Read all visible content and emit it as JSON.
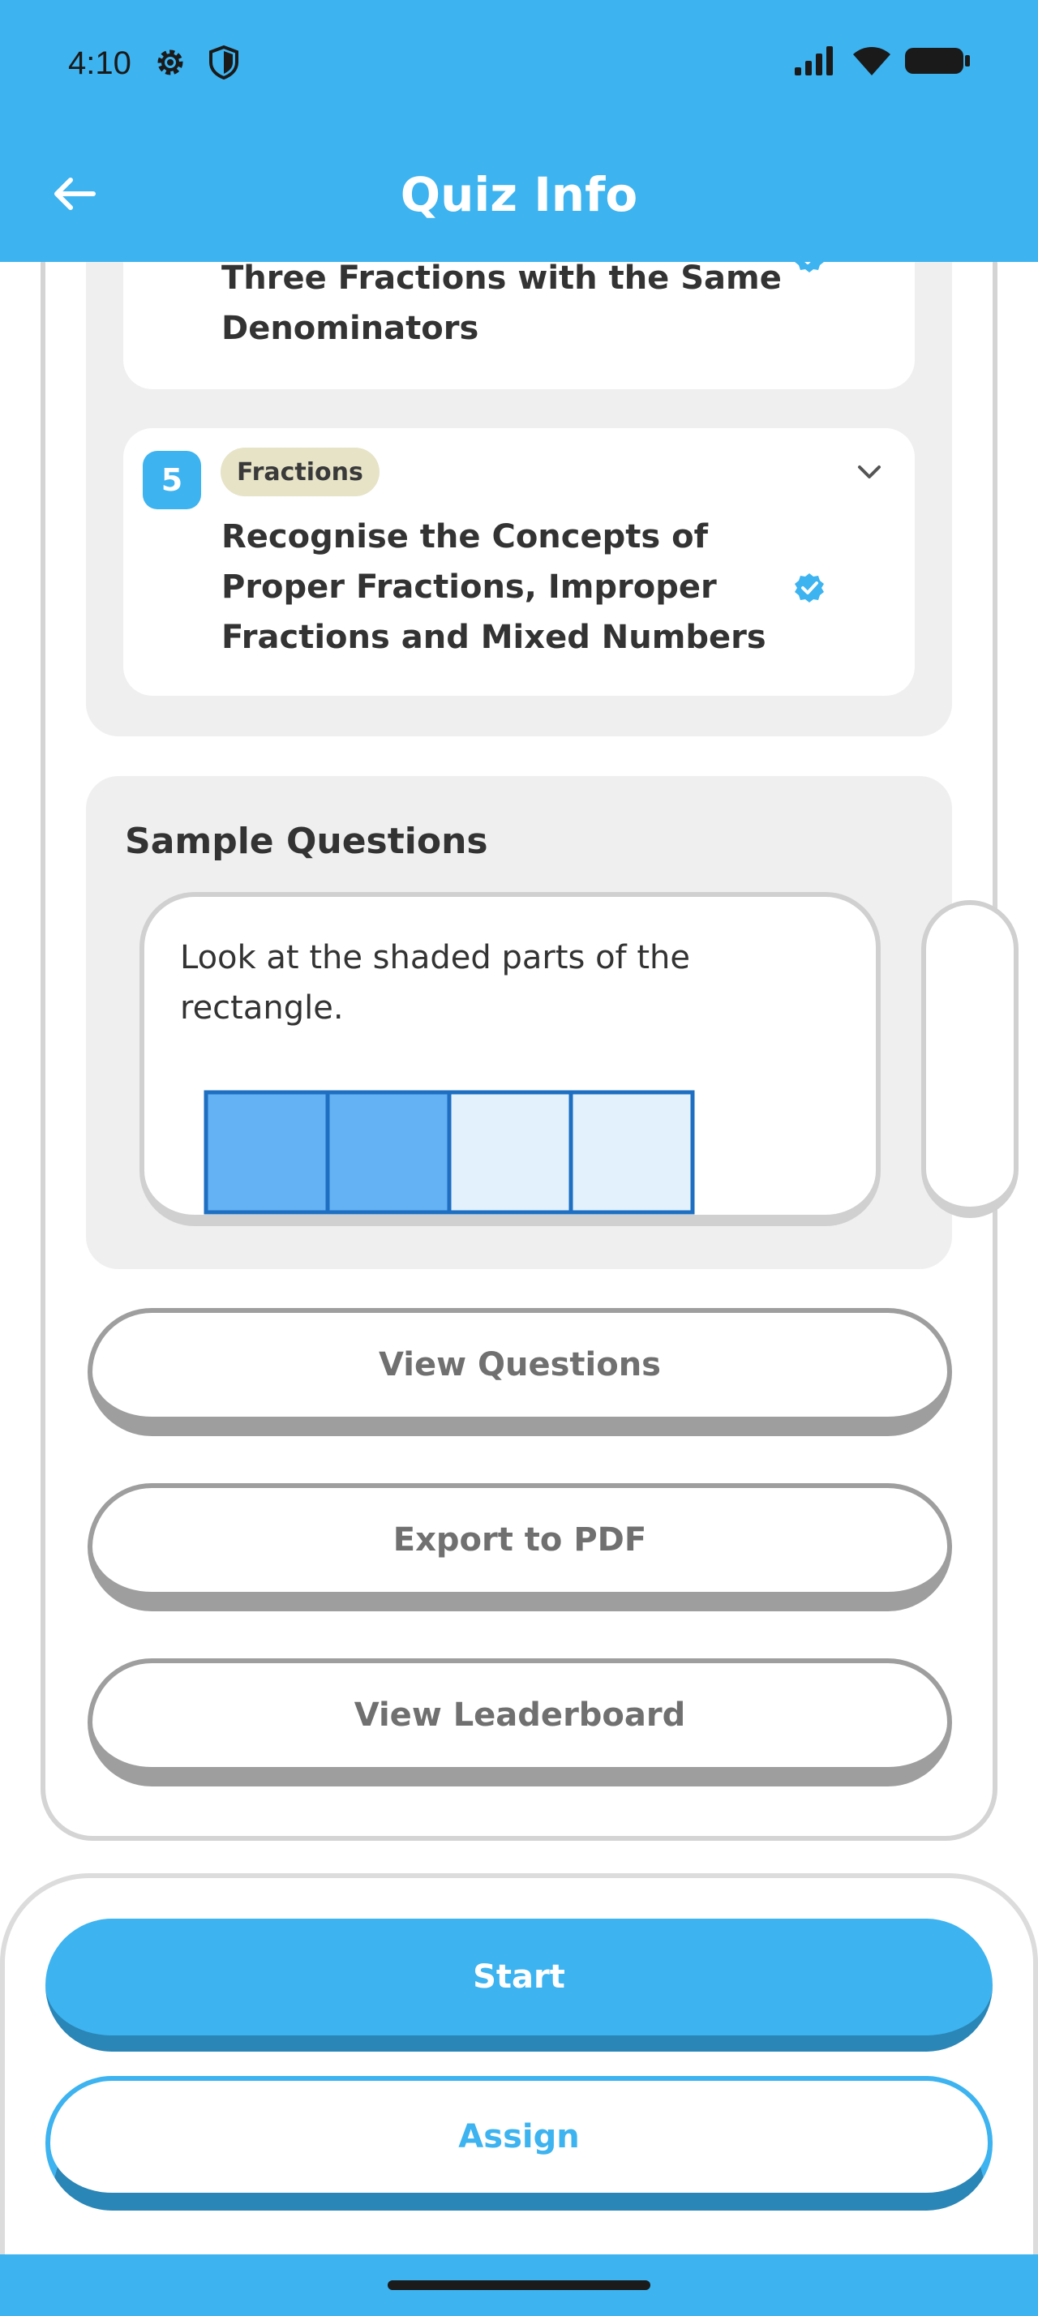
{
  "status_bar": {
    "time": "4:10",
    "left_icons": [
      "gear-icon",
      "shield-icon"
    ],
    "right_icons": [
      "signal-icon",
      "wifi-icon",
      "battery-icon"
    ]
  },
  "header": {
    "title": "Quiz Info",
    "back_icon": "arrow-left-icon",
    "background_color": "#3db3f0"
  },
  "learning_objectives": [
    {
      "title_lines": [
        "Three Fractions with the Same",
        "Denominators"
      ],
      "verified": true
    },
    {
      "number": "5",
      "topic": "Fractions",
      "title_lines": [
        "Recognise the Concepts of",
        "Proper Fractions, Improper",
        "Fractions and Mixed Numbers"
      ],
      "verified": true,
      "expand_icon": "chevron-down-icon"
    }
  ],
  "sample_questions": {
    "heading": "Sample Questions",
    "cards": [
      {
        "text_lines": [
          "Look at the shaded parts of the",
          "rectangle."
        ],
        "figure": {
          "total_parts": 4,
          "shaded_parts": 2
        }
      }
    ]
  },
  "actions": {
    "view_questions": "View Questions",
    "export_pdf": "Export to PDF",
    "view_leaderboard": "View Leaderboard",
    "start": "Start",
    "assign": "Assign"
  },
  "colors": {
    "accent": "#3db3f0",
    "accent_dark": "#2a86b6",
    "topic_pill": "#e6e3c7",
    "shaded": "#64b1f3",
    "unshaded": "#e3f1fc",
    "figure_border": "#1e6fc2"
  }
}
